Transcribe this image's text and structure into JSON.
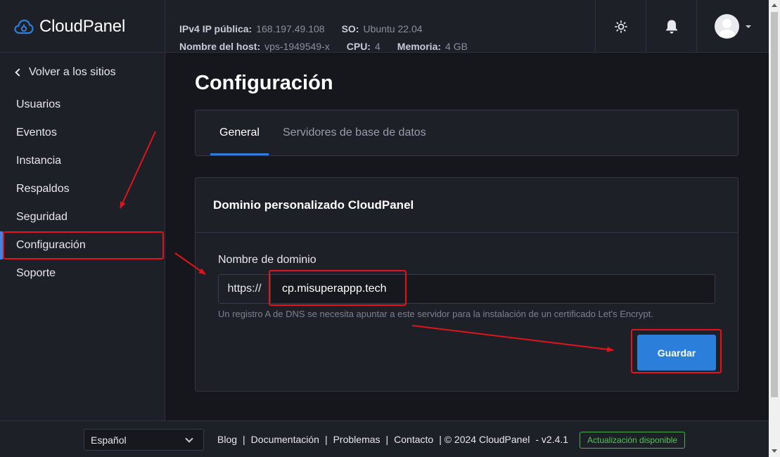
{
  "brand": {
    "name": "CloudPanel",
    "icon": "cloud-icon"
  },
  "sysinfo": {
    "ip_label": "IPv4 IP pública:",
    "ip_value": "168.197.49.108",
    "os_label": "SO:",
    "os_value": "Ubuntu 22.04",
    "host_label": "Nombre del host:",
    "host_value": "vps-1949549-x",
    "cpu_label": "CPU:",
    "cpu_value": "4",
    "mem_label": "Memoria:",
    "mem_value": "4 GB"
  },
  "header_icons": [
    "sun-icon",
    "bell-icon",
    "user-avatar-icon"
  ],
  "sidebar": {
    "back_label": "Volver a los sitios",
    "items": [
      {
        "label": "Usuarios"
      },
      {
        "label": "Eventos"
      },
      {
        "label": "Instancia"
      },
      {
        "label": "Respaldos"
      },
      {
        "label": "Seguridad"
      },
      {
        "label": "Configuración",
        "active": true
      },
      {
        "label": "Soporte"
      }
    ]
  },
  "main": {
    "title": "Configuración",
    "tabs": [
      {
        "label": "General",
        "active": true
      },
      {
        "label": "Servidores de base de datos"
      }
    ],
    "card": {
      "title": "Dominio personalizado CloudPanel",
      "field_label": "Nombre de dominio",
      "prefix": "https://",
      "domain_value": "cp.misuperappp.tech",
      "help": "Un registro A de DNS se necesita apuntar a este servidor para la instalación de un certificado Let's Encrypt.",
      "save_label": "Guardar"
    }
  },
  "footer": {
    "language": "Español",
    "links": [
      "Blog",
      "Documentación",
      "Problemas",
      "Contacto"
    ],
    "copyright": "| © 2024  CloudPanel",
    "version": "- v2.4.1",
    "update_badge": "Actualización disponible"
  },
  "colors": {
    "background": "#16171d",
    "panel": "#1e2028",
    "accent": "#2b7fdb",
    "annotation": "#e0141b",
    "update_badge": "#4caf50"
  }
}
